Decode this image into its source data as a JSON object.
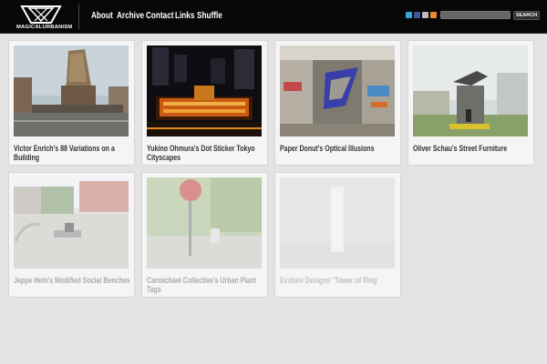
{
  "header": {
    "logo_text": "MAGICALURBANISM",
    "nav": [
      "About",
      "Archive",
      "Contact",
      "Links",
      "Shuffle"
    ],
    "social_icons": [
      "twitter-icon",
      "facebook-icon",
      "email-icon",
      "rss-icon"
    ],
    "search": {
      "placeholder": "",
      "button_label": "SEARCH"
    }
  },
  "cards": [
    {
      "title": "Victor Enrich's 88 Variations on a Building",
      "image": "tower-photo"
    },
    {
      "title": "Yukino Ohmura's Dot Sticker Tokyo Cityscapes",
      "image": "tokyo-night-photo"
    },
    {
      "title": "Paper Donut's Optical Illusions",
      "image": "graffiti-illusion-photo"
    },
    {
      "title": "Oliver Schau's Street Furniture",
      "image": "sculpture-photo"
    },
    {
      "title": "Jeppe Hein's Modified Social Benches",
      "image": "bench-photo"
    },
    {
      "title": "Carmichael Collective's Urban Plant Tags",
      "image": "stop-sign-photo"
    },
    {
      "title": "Exsture Designs' 'Tower of Ring'",
      "image": "tower-render"
    }
  ],
  "colors": {
    "header_bg": "#070707",
    "page_bg": "#e3e3e3",
    "card_bg": "#f5f5f5",
    "caption_text": "#333333"
  }
}
